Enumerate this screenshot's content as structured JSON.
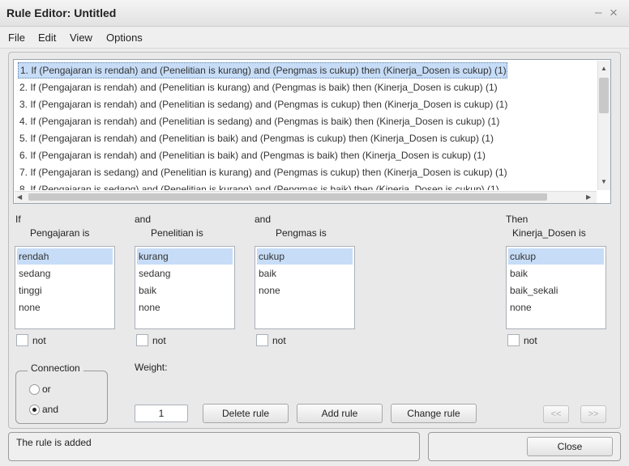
{
  "window": {
    "title": "Rule Editor: Untitled",
    "minimize_glyph": "–",
    "close_glyph": "×"
  },
  "menu": [
    "File",
    "Edit",
    "View",
    "Options"
  ],
  "rules": [
    "1. If (Pengajaran is rendah) and (Penelitian is kurang) and (Pengmas is cukup) then (Kinerja_Dosen is cukup) (1)",
    "2. If (Pengajaran is rendah) and (Penelitian is kurang) and (Pengmas is baik) then (Kinerja_Dosen is cukup) (1)",
    "3. If (Pengajaran is rendah) and (Penelitian is sedang) and (Pengmas is cukup) then (Kinerja_Dosen is cukup) (1)",
    "4. If (Pengajaran is rendah) and (Penelitian is sedang) and (Pengmas is baik) then (Kinerja_Dosen is cukup) (1)",
    "5. If (Pengajaran is rendah) and (Penelitian is baik) and (Pengmas is cukup) then (Kinerja_Dosen is cukup) (1)",
    "6. If (Pengajaran is rendah) and (Penelitian is baik) and (Pengmas is baik) then (Kinerja_Dosen is cukup) (1)",
    "7. If (Pengajaran is sedang) and (Penelitian is kurang) and (Pengmas is cukup) then (Kinerja_Dosen is cukup) (1)",
    "8. If (Pengajaran is sedang) and (Penelitian is kurang) and (Pengmas is baik) then (Kinerja_Dosen is cukup) (1)"
  ],
  "scroll_arrows": {
    "up": "▲",
    "down": "▼",
    "left": "◀",
    "right": "▶"
  },
  "inputs": {
    "pengajaran": {
      "prefix": "If",
      "label": "Pengajaran is",
      "items": [
        "rendah",
        "sedang",
        "tinggi",
        "none"
      ]
    },
    "penelitian": {
      "prefix": "and",
      "label": "Penelitian is",
      "items": [
        "kurang",
        "sedang",
        "baik",
        "none"
      ]
    },
    "pengmas": {
      "prefix": "and",
      "label": "Pengmas is",
      "items": [
        "cukup",
        "baik",
        "none"
      ]
    }
  },
  "output": {
    "prefix": "Then",
    "label": "Kinerja_Dosen is",
    "items": [
      "cukup",
      "baik",
      "baik_sekali",
      "none"
    ]
  },
  "not_label": "not",
  "connection": {
    "title": "Connection",
    "or_label": "or",
    "and_label": "and",
    "selected": "and"
  },
  "weight": {
    "label": "Weight:",
    "value": "1"
  },
  "buttons": {
    "delete": "Delete rule",
    "add": "Add rule",
    "change": "Change rule",
    "prev": "<<",
    "next": ">>",
    "close": "Close"
  },
  "status": "The rule is added"
}
